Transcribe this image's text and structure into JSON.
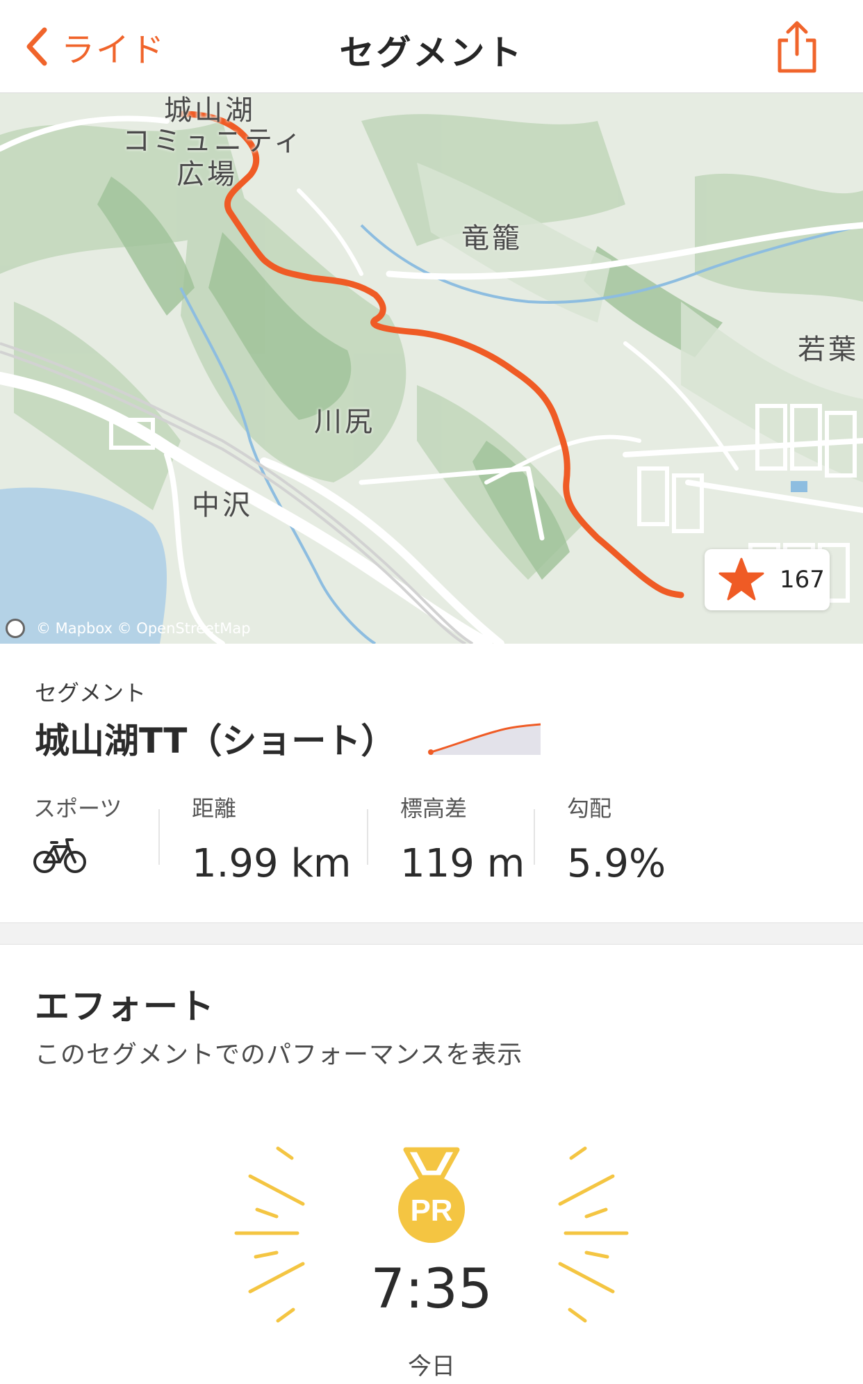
{
  "nav": {
    "back_label": "ライド",
    "title": "セグメント",
    "share_icon": "share-icon"
  },
  "map": {
    "places": {
      "jouyama": "城山湖",
      "community1": "コミュニティ",
      "community2": "広場",
      "ryuro": "竜籠",
      "wakaba": "若葉",
      "kawajiri": "川尻",
      "nakazawa": "中沢"
    },
    "attribution": "© Mapbox © OpenStreetMap",
    "star_count": "167",
    "route_color": "#ef5b25"
  },
  "segment": {
    "label": "セグメント",
    "name": "城山湖TT（ショート）",
    "stats": {
      "sport_label": "スポーツ",
      "sport_icon": "bicycle-icon",
      "distance_label": "距離",
      "distance_value": "1.99 km",
      "elevation_label": "標高差",
      "elevation_value": "119 m",
      "grade_label": "勾配",
      "grade_value": "5.9%"
    }
  },
  "effort": {
    "title": "エフォート",
    "subtitle": "このセグメントでのパフォーマンスを表示",
    "medal_label": "PR",
    "time": "7:35",
    "date": "今日",
    "medal_color": "#f4c542"
  }
}
